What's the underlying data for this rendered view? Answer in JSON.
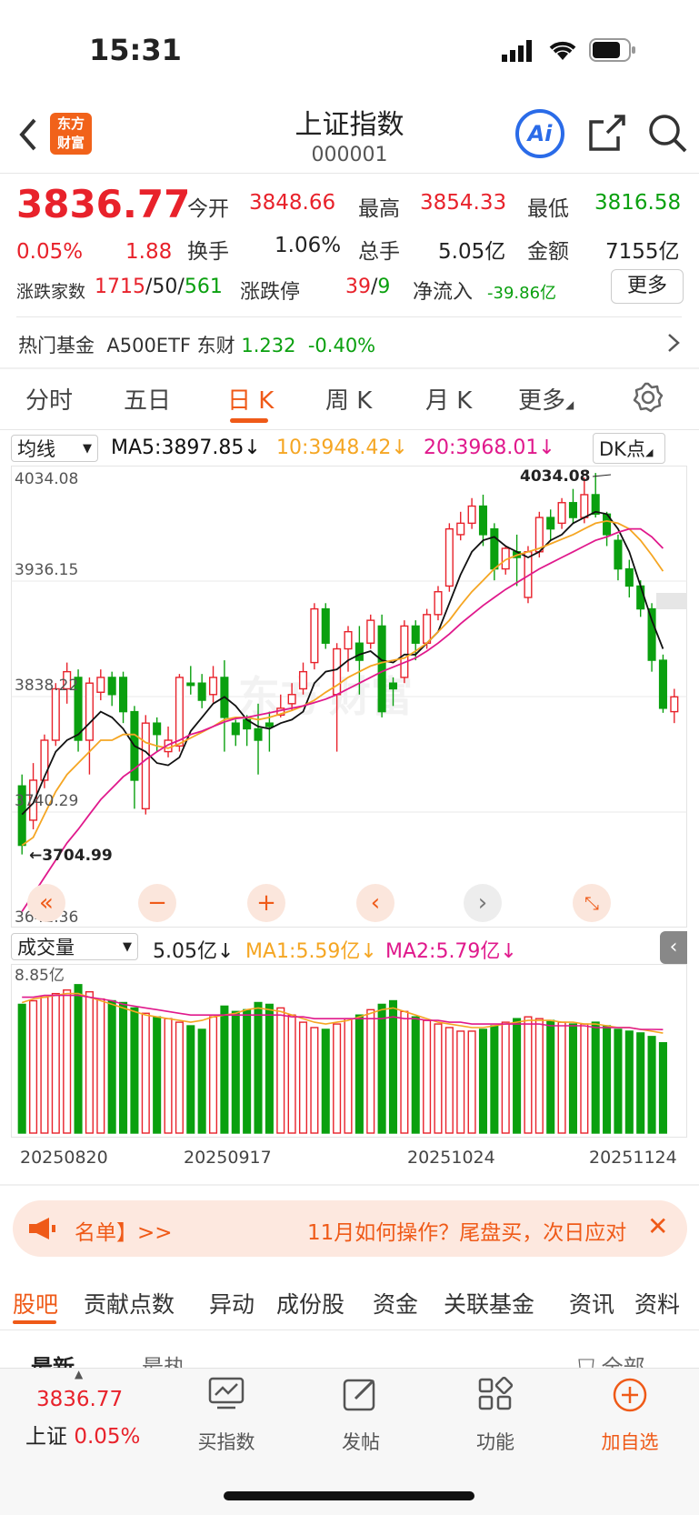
{
  "status": {
    "time": "15:31"
  },
  "header": {
    "logo_line1": "东方",
    "logo_line2": "财富",
    "title": "上证指数",
    "code": "000001",
    "ai_label": "Ai"
  },
  "quote": {
    "price": "3836.77",
    "pct": "0.05%",
    "change": "1.88",
    "open_label": "今开",
    "open": "3848.66",
    "high_label": "最高",
    "high": "3854.33",
    "low_label": "最低",
    "low": "3816.58",
    "turnover_label": "换手",
    "turnover": "1.06%",
    "volume_label": "总手",
    "volume": "5.05亿",
    "amount_label": "金额",
    "amount": "7155亿",
    "breadth_label": "涨跌家数",
    "up": "1715",
    "flat": "50",
    "down": "561",
    "slash": "/",
    "limit_label": "涨跌停",
    "limit_up": "39",
    "limit_down": "9",
    "inflow_label": "净流入",
    "inflow": "-39.86亿",
    "more_label": "更多"
  },
  "hot_fund": {
    "label": "热门基金",
    "name": "A500ETF 东财",
    "price": "1.232",
    "pct": "-0.40%"
  },
  "chart_tabs": [
    "分时",
    "五日",
    "日 K",
    "周 K",
    "月 K",
    "更多"
  ],
  "ma": {
    "selector": "均线",
    "ma5": "MA5:3897.85↓",
    "ma10": "10:3948.42↓",
    "ma20": "20:3968.01↓",
    "dk": "DK点",
    "color_ma5": "#111111",
    "color_ma10": "#f5a623",
    "color_ma20": "#e0198c"
  },
  "price_axis": [
    "4034.08",
    "3936.15",
    "3838.22",
    "3740.29",
    "3642.36"
  ],
  "annotations": {
    "high": "4034.08",
    "low": "3704.99"
  },
  "volume": {
    "selector": "成交量",
    "value": "5.05亿↓",
    "ma1": "MA1:5.59亿↓",
    "ma2": "MA2:5.79亿↓",
    "max_label": "8.85亿"
  },
  "dates": [
    "20250820",
    "20250917",
    "20251024",
    "20251124"
  ],
  "banner": {
    "left": "名单】>>",
    "text": "11月如何操作？尾盘买，次日应对"
  },
  "guba_tabs": [
    "股吧",
    "贡献点数",
    "异动",
    "成份股",
    "资金",
    "关联基金",
    "资讯",
    "资料"
  ],
  "sort": {
    "latest": "最新",
    "hot": "最热",
    "all": "全部"
  },
  "bottom": {
    "price": "3836.77",
    "name": "上证",
    "pct": "0.05%",
    "buy": "买指数",
    "post": "发帖",
    "func": "功能",
    "add": "加自选"
  },
  "chart_data": {
    "type": "candlestick",
    "ylim": [
      3642.36,
      4034.08
    ],
    "series": [
      {
        "o": 3760,
        "c": 3708,
        "h": 3770,
        "l": 3700
      },
      {
        "o": 3730,
        "c": 3765,
        "h": 3780,
        "l": 3722
      },
      {
        "o": 3765,
        "c": 3800,
        "h": 3805,
        "l": 3758
      },
      {
        "o": 3800,
        "c": 3845,
        "h": 3850,
        "l": 3795
      },
      {
        "o": 3845,
        "c": 3860,
        "h": 3868,
        "l": 3832
      },
      {
        "o": 3855,
        "c": 3800,
        "h": 3862,
        "l": 3790
      },
      {
        "o": 3800,
        "c": 3850,
        "h": 3855,
        "l": 3770
      },
      {
        "o": 3842,
        "c": 3855,
        "h": 3862,
        "l": 3835
      },
      {
        "o": 3855,
        "c": 3840,
        "h": 3860,
        "l": 3830
      },
      {
        "o": 3855,
        "c": 3825,
        "h": 3860,
        "l": 3815
      },
      {
        "o": 3825,
        "c": 3765,
        "h": 3830,
        "l": 3740
      },
      {
        "o": 3740,
        "c": 3815,
        "h": 3822,
        "l": 3735
      },
      {
        "o": 3815,
        "c": 3805,
        "h": 3820,
        "l": 3790
      },
      {
        "o": 3790,
        "c": 3800,
        "h": 3812,
        "l": 3785
      },
      {
        "o": 3795,
        "c": 3855,
        "h": 3858,
        "l": 3790
      },
      {
        "o": 3850,
        "c": 3848,
        "h": 3865,
        "l": 3840
      },
      {
        "o": 3850,
        "c": 3835,
        "h": 3858,
        "l": 3828
      },
      {
        "o": 3840,
        "c": 3855,
        "h": 3865,
        "l": 3833
      },
      {
        "o": 3855,
        "c": 3820,
        "h": 3870,
        "l": 3790
      },
      {
        "o": 3815,
        "c": 3805,
        "h": 3818,
        "l": 3795
      },
      {
        "o": 3818,
        "c": 3810,
        "h": 3822,
        "l": 3795
      },
      {
        "o": 3810,
        "c": 3800,
        "h": 3832,
        "l": 3770
      },
      {
        "o": 3815,
        "c": 3812,
        "h": 3825,
        "l": 3790
      },
      {
        "o": 3822,
        "c": 3828,
        "h": 3840,
        "l": 3820
      },
      {
        "o": 3832,
        "c": 3840,
        "h": 3850,
        "l": 3826
      },
      {
        "o": 3845,
        "c": 3860,
        "h": 3868,
        "l": 3840
      },
      {
        "o": 3868,
        "c": 3915,
        "h": 3920,
        "l": 3862
      },
      {
        "o": 3915,
        "c": 3885,
        "h": 3920,
        "l": 3880
      },
      {
        "o": 3840,
        "c": 3880,
        "h": 3885,
        "l": 3790
      },
      {
        "o": 3880,
        "c": 3895,
        "h": 3900,
        "l": 3860
      },
      {
        "o": 3885,
        "c": 3870,
        "h": 3900,
        "l": 3840
      },
      {
        "o": 3885,
        "c": 3905,
        "h": 3910,
        "l": 3880
      },
      {
        "o": 3900,
        "c": 3825,
        "h": 3910,
        "l": 3820
      },
      {
        "o": 3850,
        "c": 3845,
        "h": 3855,
        "l": 3830
      },
      {
        "o": 3855,
        "c": 3900,
        "h": 3905,
        "l": 3850
      },
      {
        "o": 3900,
        "c": 3885,
        "h": 3905,
        "l": 3870
      },
      {
        "o": 3885,
        "c": 3910,
        "h": 3915,
        "l": 3880
      },
      {
        "o": 3910,
        "c": 3930,
        "h": 3935,
        "l": 3905
      },
      {
        "o": 3935,
        "c": 3985,
        "h": 3990,
        "l": 3930
      },
      {
        "o": 3980,
        "c": 3990,
        "h": 4000,
        "l": 3975
      },
      {
        "o": 3990,
        "c": 4005,
        "h": 4012,
        "l": 3985
      },
      {
        "o": 4005,
        "c": 3980,
        "h": 4015,
        "l": 3970
      },
      {
        "o": 3985,
        "c": 3950,
        "h": 3990,
        "l": 3940
      },
      {
        "o": 3950,
        "c": 3968,
        "h": 3970,
        "l": 3945
      },
      {
        "o": 3965,
        "c": 3960,
        "h": 3980,
        "l": 3935
      },
      {
        "o": 3925,
        "c": 3965,
        "h": 3970,
        "l": 3920
      },
      {
        "o": 3965,
        "c": 3995,
        "h": 4000,
        "l": 3960
      },
      {
        "o": 3995,
        "c": 3985,
        "h": 4002,
        "l": 3975
      },
      {
        "o": 3990,
        "c": 4008,
        "h": 4012,
        "l": 3985
      },
      {
        "o": 4008,
        "c": 3995,
        "h": 4020,
        "l": 3990
      },
      {
        "o": 3995,
        "c": 4015,
        "h": 4030,
        "l": 3990
      },
      {
        "o": 4015,
        "c": 3998,
        "h": 4034,
        "l": 3995
      },
      {
        "o": 3998,
        "c": 3980,
        "h": 4000,
        "l": 3970
      },
      {
        "o": 3975,
        "c": 3950,
        "h": 3980,
        "l": 3940
      },
      {
        "o": 3950,
        "c": 3935,
        "h": 3958,
        "l": 3925
      },
      {
        "o": 3935,
        "c": 3915,
        "h": 3940,
        "l": 3908
      },
      {
        "o": 3915,
        "c": 3870,
        "h": 3920,
        "l": 3860
      },
      {
        "o": 3870,
        "c": 3828,
        "h": 3875,
        "l": 3824
      },
      {
        "o": 3825,
        "c": 3838,
        "h": 3845,
        "l": 3815
      }
    ],
    "ma5": [
      3735,
      3745,
      3768,
      3790,
      3800,
      3805,
      3815,
      3825,
      3820,
      3810,
      3795,
      3790,
      3780,
      3778,
      3785,
      3808,
      3820,
      3832,
      3838,
      3830,
      3818,
      3812,
      3810,
      3815,
      3818,
      3825,
      3850,
      3860,
      3862,
      3870,
      3875,
      3878,
      3870,
      3868,
      3875,
      3875,
      3885,
      3895,
      3920,
      3945,
      3965,
      3975,
      3978,
      3970,
      3965,
      3960,
      3965,
      3975,
      3980,
      3990,
      3995,
      4000,
      3998,
      3985,
      3965,
      3935,
      3905,
      3880
    ],
    "ma10": [
      3708,
      3715,
      3735,
      3755,
      3770,
      3780,
      3790,
      3800,
      3800,
      3805,
      3805,
      3798,
      3795,
      3793,
      3797,
      3802,
      3807,
      3812,
      3818,
      3820,
      3820,
      3818,
      3820,
      3823,
      3826,
      3830,
      3835,
      3842,
      3848,
      3855,
      3860,
      3865,
      3868,
      3870,
      3872,
      3878,
      3885,
      3895,
      3905,
      3918,
      3930,
      3940,
      3950,
      3958,
      3962,
      3965,
      3968,
      3972,
      3976,
      3980,
      3985,
      3990,
      3992,
      3990,
      3985,
      3975,
      3962,
      3948
    ],
    "ma20": [
      3650,
      3665,
      3680,
      3695,
      3710,
      3722,
      3735,
      3748,
      3758,
      3768,
      3775,
      3783,
      3790,
      3796,
      3800,
      3805,
      3808,
      3812,
      3816,
      3819,
      3820,
      3822,
      3824,
      3826,
      3828,
      3830,
      3833,
      3836,
      3840,
      3845,
      3850,
      3855,
      3860,
      3864,
      3868,
      3872,
      3878,
      3885,
      3893,
      3902,
      3910,
      3918,
      3925,
      3932,
      3938,
      3944,
      3950,
      3955,
      3960,
      3965,
      3970,
      3975,
      3978,
      3982,
      3985,
      3985,
      3978,
      3968
    ],
    "volume": [
      7.2,
      7.4,
      7.6,
      7.8,
      8.0,
      8.3,
      7.9,
      7.5,
      7.4,
      7.3,
      7.0,
      6.7,
      6.5,
      6.4,
      6.2,
      6.0,
      5.8,
      6.5,
      7.1,
      6.8,
      6.9,
      7.3,
      7.2,
      7.0,
      6.6,
      6.2,
      5.9,
      5.8,
      6.1,
      6.4,
      6.6,
      6.9,
      7.2,
      7.4,
      6.8,
      6.5,
      6.3,
      6.1,
      5.9,
      5.7,
      5.7,
      5.8,
      6.0,
      6.2,
      6.4,
      6.5,
      6.4,
      6.3,
      6.2,
      6.1,
      6.1,
      6.2,
      6.0,
      5.8,
      5.7,
      5.6,
      5.4,
      5.05
    ],
    "vol_ma1": [
      7.3,
      7.5,
      7.6,
      7.7,
      7.8,
      7.8,
      7.6,
      7.4,
      7.2,
      7.0,
      6.8,
      6.6,
      6.5,
      6.4,
      6.3,
      6.2,
      6.3,
      6.5,
      6.6,
      6.7,
      6.9,
      7.0,
      6.9,
      6.8,
      6.6,
      6.4,
      6.2,
      6.1,
      6.2,
      6.3,
      6.5,
      6.7,
      6.9,
      7.0,
      6.8,
      6.6,
      6.4,
      6.2,
      6.1,
      6.0,
      5.9,
      5.9,
      6.0,
      6.1,
      6.2,
      6.3,
      6.3,
      6.3,
      6.2,
      6.2,
      6.1,
      6.1,
      6.0,
      5.9,
      5.9,
      5.8,
      5.7,
      5.59
    ],
    "vol_ma2": [
      7.6,
      7.6,
      7.7,
      7.7,
      7.7,
      7.7,
      7.6,
      7.5,
      7.4,
      7.2,
      7.1,
      7.0,
      6.9,
      6.8,
      6.7,
      6.6,
      6.6,
      6.6,
      6.6,
      6.6,
      6.6,
      6.6,
      6.6,
      6.6,
      6.5,
      6.5,
      6.4,
      6.4,
      6.4,
      6.4,
      6.4,
      6.4,
      6.4,
      6.5,
      6.4,
      6.4,
      6.3,
      6.3,
      6.2,
      6.2,
      6.1,
      6.1,
      6.1,
      6.1,
      6.1,
      6.1,
      6.1,
      6.0,
      6.0,
      6.0,
      6.0,
      5.9,
      5.9,
      5.9,
      5.9,
      5.8,
      5.8,
      5.79
    ],
    "vol_max": 8.85
  }
}
